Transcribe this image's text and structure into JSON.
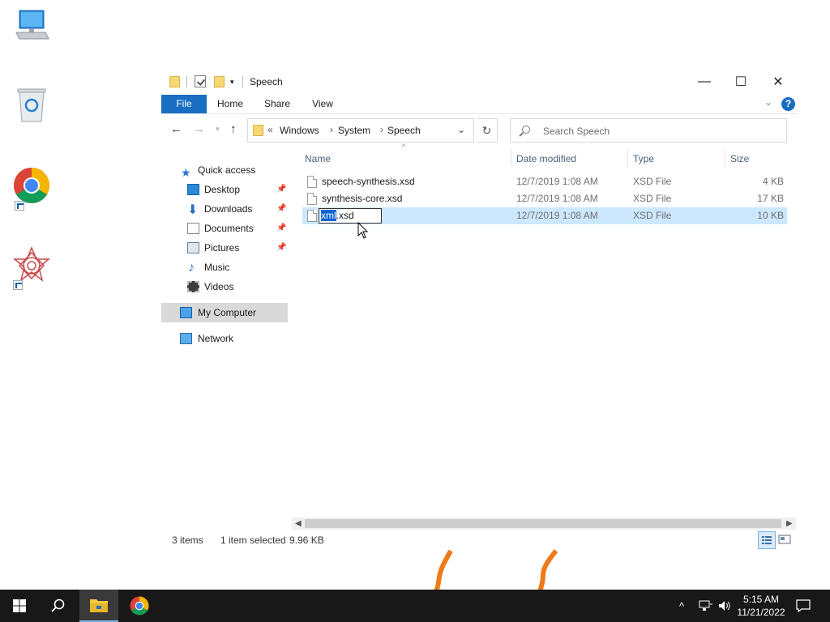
{
  "desktop": {
    "icons": [
      {
        "name": "this-pc-icon"
      },
      {
        "name": "recycle-bin-icon"
      },
      {
        "name": "chrome-shortcut-icon"
      },
      {
        "name": "app-shortcut-icon"
      }
    ]
  },
  "window": {
    "title": "Speech",
    "caption": {
      "minimize": "—",
      "maximize": "☐",
      "close": "✕"
    }
  },
  "ribbon": {
    "tabs": [
      "File",
      "Home",
      "Share",
      "View"
    ],
    "help": "?"
  },
  "address": {
    "overflow": "«",
    "crumbs": [
      "Windows",
      "System",
      "Speech"
    ]
  },
  "search": {
    "placeholder": "Search Speech"
  },
  "sidebar": {
    "items": [
      {
        "label": "Quick access",
        "icon": "star-icon"
      },
      {
        "label": "Desktop",
        "icon": "desktop-folder-icon",
        "pinned": true
      },
      {
        "label": "Downloads",
        "icon": "download-arrow-icon",
        "pinned": true
      },
      {
        "label": "Documents",
        "icon": "documents-icon",
        "pinned": true
      },
      {
        "label": "Pictures",
        "icon": "pictures-icon",
        "pinned": true
      },
      {
        "label": "Music",
        "icon": "music-note-icon"
      },
      {
        "label": "Videos",
        "icon": "film-icon"
      },
      {
        "label": "My Computer",
        "icon": "computer-icon",
        "selected": true
      },
      {
        "label": "Network",
        "icon": "network-icon"
      }
    ]
  },
  "columns": [
    "Name",
    "Date modified",
    "Type",
    "Size"
  ],
  "files": [
    {
      "name": "speech-synthesis.xsd",
      "date": "12/7/2019 1:08 AM",
      "type": "XSD File",
      "size": "4 KB"
    },
    {
      "name": "synthesis-core.xsd",
      "date": "12/7/2019 1:08 AM",
      "type": "XSD File",
      "size": "17 KB"
    },
    {
      "name": "xml.xsd",
      "date": "12/7/2019 1:08 AM",
      "type": "XSD File",
      "size": "10 KB",
      "selected": true,
      "renaming": true,
      "rename_selected": "xml",
      "rename_rest": ".xsd"
    }
  ],
  "status": {
    "items": "3 items",
    "selected": "1 item selected",
    "size": "9.96 KB"
  },
  "taskbar": {
    "clock_time": "5:15 AM",
    "clock_date": "11/21/2022"
  },
  "colors": {
    "accent": "#1a6ec2",
    "selection": "#cce8ff",
    "taskbar": "#181818"
  }
}
